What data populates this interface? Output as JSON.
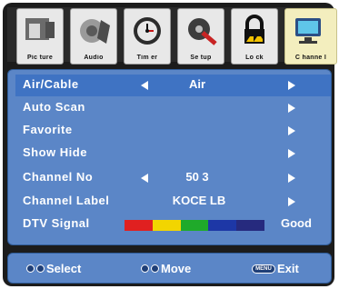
{
  "tabs": [
    {
      "label": "Pic ture",
      "icon": "picture-icon"
    },
    {
      "label": "Audio",
      "icon": "audio-icon"
    },
    {
      "label": "Tim er",
      "icon": "timer-icon"
    },
    {
      "label": "Se tup",
      "icon": "setup-icon"
    },
    {
      "label": "Lo ck",
      "icon": "lock-icon"
    },
    {
      "label": "C hanne l",
      "icon": "channel-icon",
      "active": true
    }
  ],
  "menu": [
    {
      "label": "Air/Cable",
      "value": "Air",
      "left_arrow": true,
      "right_arrow": true
    },
    {
      "label": "Auto Scan",
      "value": "",
      "left_arrow": false,
      "right_arrow": true
    },
    {
      "label": "Favorite",
      "value": "",
      "left_arrow": false,
      "right_arrow": true
    },
    {
      "label": "Show Hide",
      "value": "",
      "left_arrow": false,
      "right_arrow": true
    },
    {
      "label": "Channel No",
      "value": "50 3",
      "left_arrow": true,
      "right_arrow": true
    },
    {
      "label": "Channel Label",
      "value": "KOCE LB",
      "left_arrow": false,
      "right_arrow": true
    },
    {
      "label": "DTV Signal",
      "value": "Good",
      "left_arrow": false,
      "right_arrow": false
    }
  ],
  "signal": {
    "quality": "Good",
    "segments": [
      "#e02020",
      "#f2d500",
      "#1faa2a",
      "#1d37a6",
      "#262a7e"
    ]
  },
  "help": {
    "select": "Select",
    "move": "Move",
    "menu_key": "MENU",
    "exit": "Exit"
  }
}
